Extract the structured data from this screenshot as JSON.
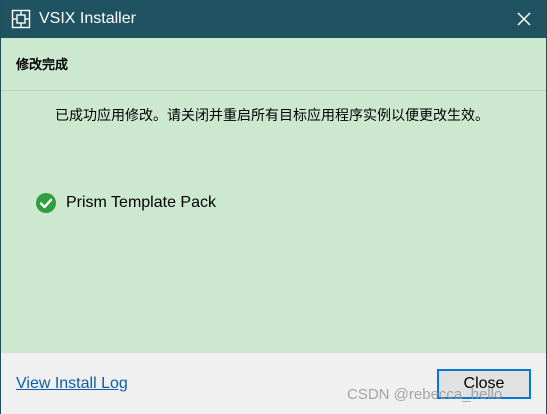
{
  "window": {
    "title": "VSIX Installer",
    "icons": {
      "app": "vsix-installer-icon",
      "close": "close-icon"
    }
  },
  "content": {
    "heading": "修改完成",
    "message": "已成功应用修改。请关闭并重启所有目标应用程序实例以便更改生效。",
    "extension": {
      "name": "Prism Template Pack",
      "status_icon": "check-circle-icon"
    }
  },
  "footer": {
    "log_link": "View Install Log",
    "close_button": "Close"
  },
  "watermark": "CSDN @rebecca_hello",
  "colors": {
    "titlebar": "#1f5362",
    "background": "#cce8cf",
    "footer": "#f0f0f0",
    "link": "#0b5fa8",
    "check": "#2e9e3e",
    "button_border": "#0078d7"
  }
}
